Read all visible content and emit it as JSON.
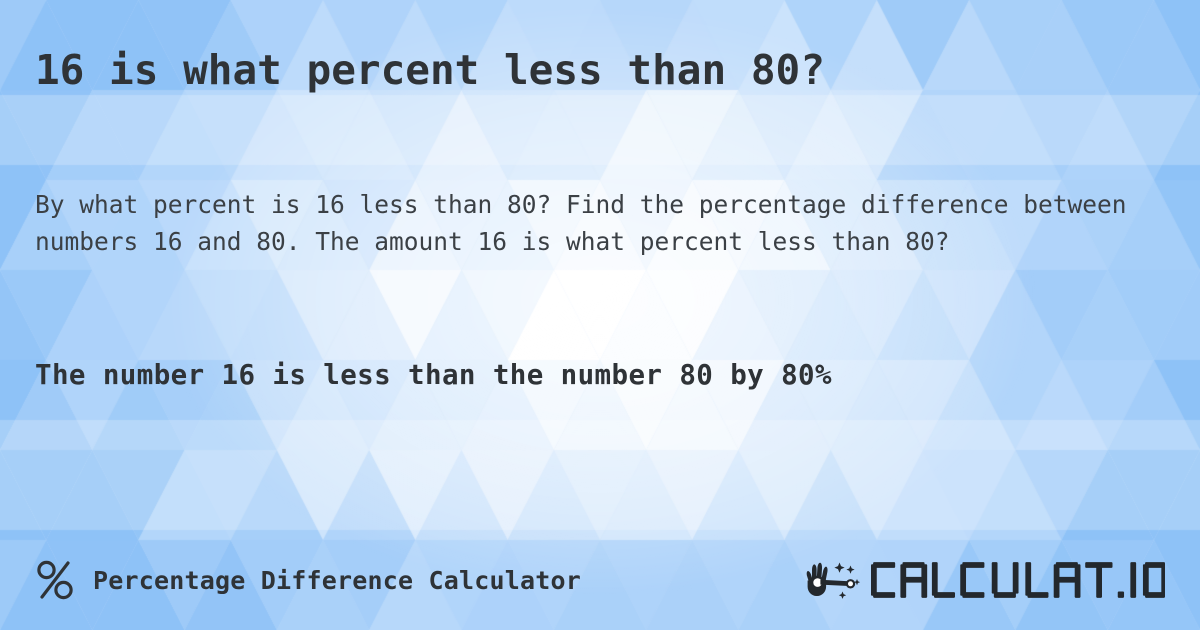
{
  "meta": {
    "accent_color": "#2f3337",
    "background_base_color": "#bfdcfb",
    "background_light_color": "#ffffff",
    "background_blue_color": "#8ec2f7",
    "pattern": "low-poly-triangles"
  },
  "heading": {
    "text": "16 is what percent less than 80?"
  },
  "intro": {
    "text": "By what percent is 16 less than 80? Find the percentage difference between numbers 16 and 80. The amount 16 is what percent less than 80?"
  },
  "answer": {
    "text": "The number 16 is less than the number 80 by 80%"
  },
  "problem": {
    "value_a": "16",
    "value_b": "80",
    "result_percent": "80%"
  },
  "footer": {
    "percent_icon": "percent-icon",
    "label": "Percentage Difference Calculator",
    "brand": {
      "mark_icon": "hand-magic-wand-icon",
      "name": "CALCULAT.IO"
    }
  }
}
